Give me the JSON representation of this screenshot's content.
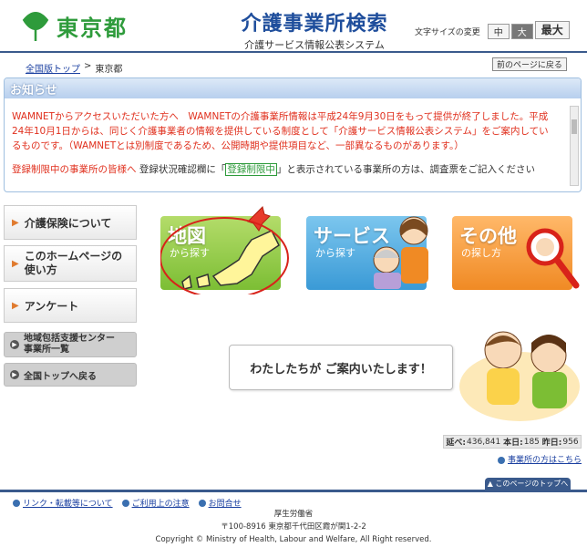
{
  "header": {
    "logo_text": "東京都",
    "title": "介護事業所検索",
    "subtitle": "介護サービス情報公表システム",
    "fontsize_label": "文字サイズの変更",
    "fontsize_options": [
      "中",
      "大",
      "最大"
    ]
  },
  "breadcrumb": {
    "home": "全国版トップ",
    "separator": ">",
    "current": "東京都"
  },
  "back_button": "前のページに戻る",
  "notice": {
    "heading": "お知らせ",
    "para1": "WAMNETからアクセスいただいた方へ　WAMNETの介護事業所情報は平成24年9月30日をもって提供が終了しました。平成24年10月1日からは、同じく介護事業者の情報を提供している制度として「介護サービス情報公表システム」をご案内しているものです。（WAMNETとは別制度であるため、公開時期や提供項目など、一部異なるものがあります。）",
    "para2_red": "登録制限中の事業所の皆様へ",
    "para2_dark_a": "登録状況確認欄に「",
    "para2_green": "登録制限中",
    "para2_dark_b": "」と表示されている事業所の方は、調査票をご記入ください"
  },
  "menu": {
    "kaigo": "介護保険について",
    "howto_line1": "このホームページの",
    "howto_line2": "使い方",
    "survey": "アンケート",
    "center_line1": "地域包括支援センター",
    "center_line2": "事業所一覧",
    "home": "全国トップへ戻る"
  },
  "tiles": {
    "map": {
      "title": "地図",
      "sub": "から探す"
    },
    "service": {
      "title": "サービス",
      "sub": "から探す"
    },
    "other": {
      "title": "その他",
      "sub": "の探し方"
    }
  },
  "bubble_text": "わたしたちが ご案内いたします！",
  "counter": {
    "total_label": "延べ:",
    "total": "436,841",
    "today_label": "本日:",
    "today": "185",
    "yesterday_label": "昨日:",
    "yesterday": "956"
  },
  "feedback_link": "事業所の方はこちら",
  "to_top": "このページのトップへ",
  "footer": {
    "links": [
      "リンク・転載等について",
      "ご利用上の注意",
      "お問合せ"
    ],
    "ministry": "厚生労働省",
    "address": "〒100-8916 東京都千代田区霞が関1-2-2",
    "copyright": "Copyright © Ministry of Health, Labour and Welfare, All Right reserved."
  },
  "colors": {
    "brand_green": "#2e9b3b",
    "title_blue": "#1f4e9c",
    "notice_red": "#e0301e",
    "footer_blue": "#3a5a8c"
  }
}
